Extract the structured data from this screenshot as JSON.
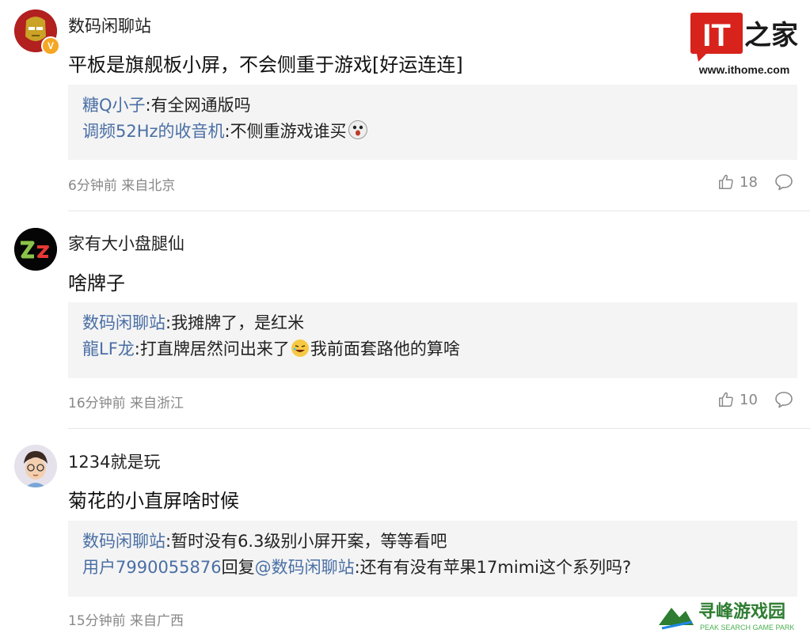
{
  "logo": {
    "it": "IT",
    "zhi": "之家",
    "url": "www.ithome.com"
  },
  "comments": [
    {
      "username": "数码闲聊站",
      "content": "平板是旗舰板小屏，不会侧重于游戏[好运连连]",
      "replies": [
        {
          "name": "糖Q小子",
          "text": ":有全网通版吗"
        },
        {
          "name": "调频52Hz的收音机",
          "text": ":不侧重游戏谁买"
        }
      ],
      "meta": "6分钟前 来自北京",
      "likes": "18"
    },
    {
      "username": "家有大小盘腿仙",
      "content": "啥牌子",
      "replies": [
        {
          "name": "数码闲聊站",
          "text": ":我摊牌了，是红米"
        },
        {
          "name": "龍LF龙",
          "text": ":打直牌居然问出来了",
          "text2": "我前面套路他的算啥"
        }
      ],
      "meta": "16分钟前 来自浙江",
      "likes": "10"
    },
    {
      "username": "1234就是玩",
      "content": "菊花的小直屏啥时候",
      "replies": [
        {
          "name": "数码闲聊站",
          "text": ":暂时没有6.3级别小屏开案，等等看吧"
        },
        {
          "name": "用户7990055876",
          "mid": "回复",
          "name2": "@数码闲聊站",
          "text": ":还有有没有苹果17mimi这个系列吗?"
        }
      ],
      "meta": "15分钟前 来自广西"
    }
  ],
  "watermark": {
    "title": "寻峰游戏园",
    "sub": "PEAK SEARCH GAME PARK"
  },
  "colors": {
    "reply_name": "#4a6fa5",
    "logo_red": "#d7231c",
    "meta": "#888888",
    "reply_bg": "#f4f4f4"
  }
}
